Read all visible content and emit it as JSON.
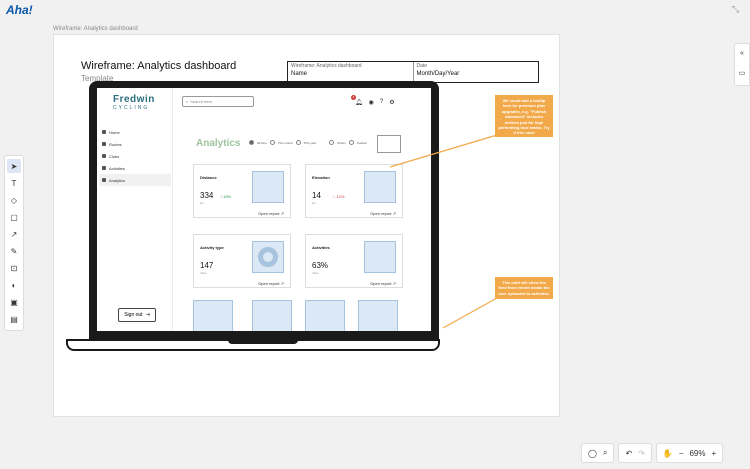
{
  "app": {
    "logo": "Aha!",
    "collapse_glyph": "⤡"
  },
  "canvas": {
    "label": "Wireframe: Analytics dashboard"
  },
  "doc": {
    "title": "Wireframe: Analytics dashboard",
    "subtitle": "Template",
    "meta": [
      {
        "label": "Wireframe: Analytics dashboard",
        "value": "Name"
      },
      {
        "label": "Date",
        "value": "Month/Day/Year"
      }
    ]
  },
  "left_tools": [
    {
      "icon": "cursor-icon",
      "glyph": "➤"
    },
    {
      "icon": "text-icon",
      "glyph": "T"
    },
    {
      "icon": "shapes-icon",
      "glyph": "◇"
    },
    {
      "icon": "sticky-note-icon",
      "glyph": "▢"
    },
    {
      "icon": "arrow-icon",
      "glyph": "↗"
    },
    {
      "icon": "pen-icon",
      "glyph": "✎"
    },
    {
      "icon": "frame-icon",
      "glyph": "⊡"
    },
    {
      "icon": "palette-icon",
      "glyph": "◐"
    },
    {
      "icon": "image-icon",
      "glyph": "▣"
    },
    {
      "icon": "template-icon",
      "glyph": "▤"
    }
  ],
  "right_tools": [
    {
      "icon": "collapse-panel-icon",
      "glyph": "«"
    },
    {
      "icon": "comment-panel-icon",
      "glyph": "▭"
    }
  ],
  "bottom": {
    "comment_glyph": "◯",
    "search_glyph": "⌕",
    "undo_glyph": "↶",
    "redo_glyph": "↷",
    "hand_glyph": "✋",
    "zoom_out": "−",
    "zoom": "69%",
    "zoom_in": "+"
  },
  "screen": {
    "brand_line1": "Fredwin",
    "brand_line2": "CYCLING",
    "nav": [
      {
        "label": "Home",
        "active": false
      },
      {
        "label": "Routes",
        "active": false
      },
      {
        "label": "Clubs",
        "active": false
      },
      {
        "label": "Activities",
        "active": false
      },
      {
        "label": "Analytics",
        "active": true
      }
    ],
    "signout": "Sign out",
    "search_placeholder": "Search here",
    "notification_count": "3",
    "heading": "Analytics",
    "filters": [
      "All time",
      "This month",
      "This year"
    ],
    "filters2": [
      "Option",
      "Custom"
    ],
    "cards": [
      {
        "title": "Distance",
        "value": "334",
        "unit": "km",
        "change": "↑ 15%",
        "up": true,
        "link": "Open report ↗"
      },
      {
        "title": "Elevation",
        "value": "14",
        "unit": "km",
        "change": "↓ -12%",
        "up": false,
        "link": "Open report ↗"
      },
      {
        "title": "Activity type",
        "value": "147",
        "unit": "rides",
        "change": "",
        "up": true,
        "link": "Open report ↗"
      },
      {
        "title": "Activities",
        "value": "63%",
        "unit": "rides",
        "change": "",
        "up": true,
        "link": "Open report ↗"
      }
    ]
  },
  "stickies": [
    "We could add a tooltip here for premium plan upgrades, e.g. \"Publish Advanced\" includes metrics just for high performing race teams. Try it free now!",
    "This card will show the feed from recent media the user uploaded to activities."
  ],
  "colors": {
    "accent": "#2b6e7f",
    "sticky": "#f2a94a",
    "thumb": "#dbe8f5",
    "up": "#2e9b4f",
    "down": "#d23b3b"
  }
}
